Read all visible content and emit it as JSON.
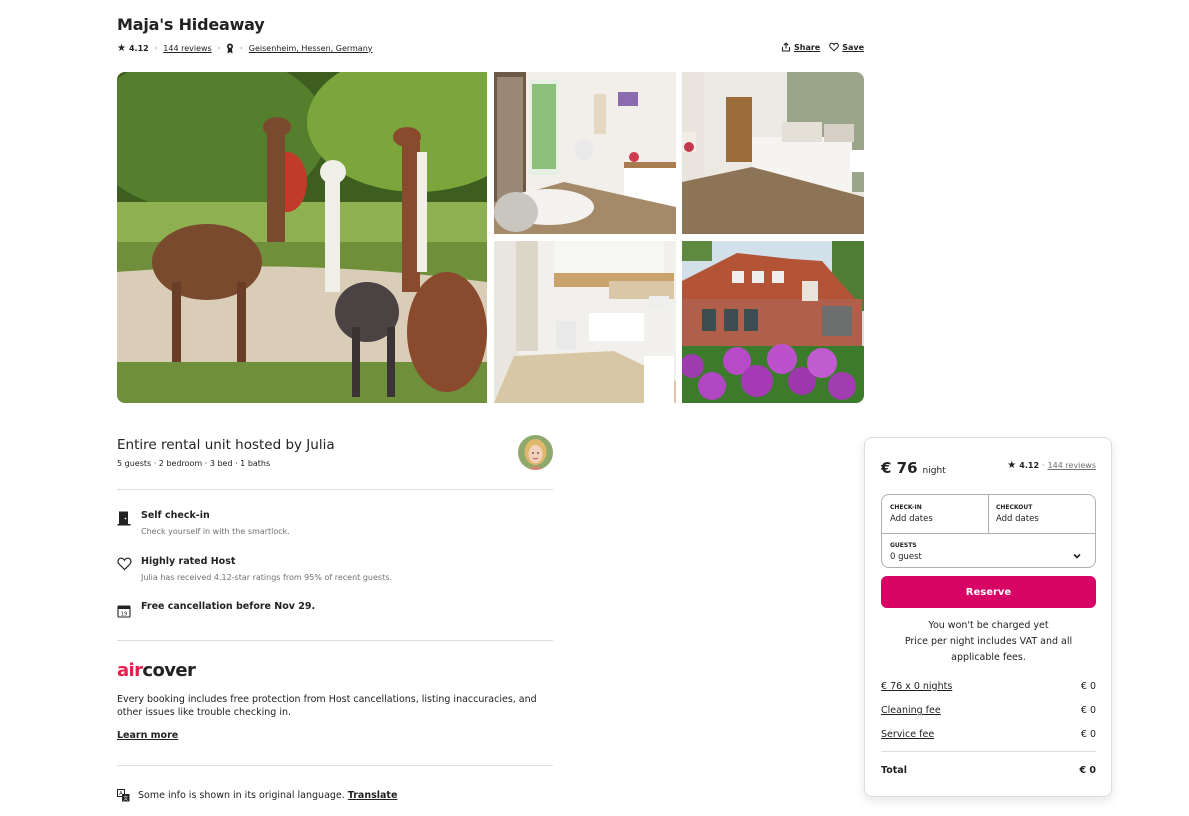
{
  "listing": {
    "title": "Maja's Hideaway",
    "rating": "4.12",
    "reviews": "144 reviews",
    "location": "Geisenheim, Hessen, Germany",
    "share_label": "Share",
    "save_label": "Save"
  },
  "host": {
    "title": "Entire rental unit hosted by Julia",
    "details": "5 guests · 2 bedroom · 3 bed · 1 baths"
  },
  "features": [
    {
      "title": "Self check-in",
      "desc": "Check yourself in with the smartlock.",
      "icon": "door-icon"
    },
    {
      "title": "Highly rated Host",
      "desc": "Julia has received 4.12-star ratings from 95% of recent guests.",
      "icon": "heart-icon"
    },
    {
      "title": "Free cancellation before Nov 29.",
      "desc": "",
      "icon": "calendar-icon"
    }
  ],
  "aircover": {
    "logo_air": "air",
    "logo_cover": "cover",
    "desc": "Every booking includes free protection from Host cancellations, listing inaccuracies, and other issues like trouble checking in.",
    "learn_more": "Learn more"
  },
  "language_notice": {
    "text": "Some info is shown in its original language.",
    "link": "Translate"
  },
  "booking": {
    "price": "€ 76",
    "per": "night",
    "rating": "4.12",
    "reviews": "144 reviews",
    "checkin_label": "CHECK-IN",
    "checkin_value": "Add dates",
    "checkout_label": "CHECKOUT",
    "checkout_value": "Add dates",
    "guests_label": "GUESTS",
    "guests_value": "0 guest",
    "reserve_label": "Reserve",
    "note_line1": "You won't be charged yet",
    "note_line2": "Price per night includes VAT and all applicable fees.",
    "fees": [
      {
        "label": "€ 76 x 0 nights",
        "value": "€ 0"
      },
      {
        "label": "Cleaning fee",
        "value": "€ 0"
      },
      {
        "label": "Service fee",
        "value": "€ 0"
      }
    ],
    "total_label": "Total",
    "total_value": "€ 0"
  },
  "colors": {
    "brand": "#d70466",
    "aircover_red": "#e61e4d",
    "text": "#222222",
    "muted": "#717171",
    "divider": "#dddddd"
  }
}
